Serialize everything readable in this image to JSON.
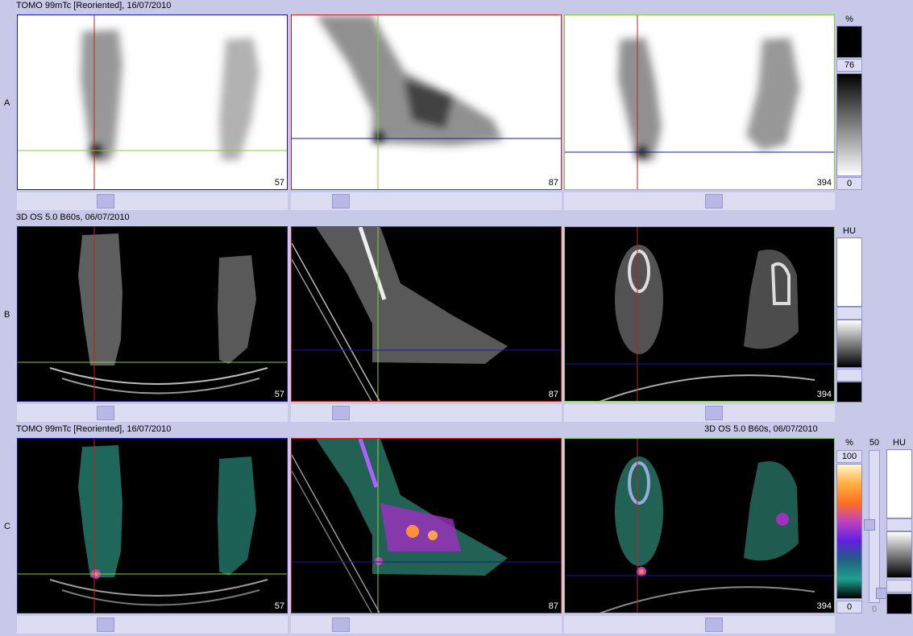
{
  "rows": [
    {
      "label": "A",
      "header": "TOMO 99mTc [Reoriented], 16/07/2010",
      "header_right": "",
      "slices": [
        "57",
        "87",
        "394"
      ]
    },
    {
      "label": "B",
      "header": "3D  OS  5.0  B60s, 06/07/2010",
      "header_right": "",
      "slices": [
        "57",
        "87",
        "394"
      ]
    },
    {
      "label": "C",
      "header": "TOMO 99mTc [Reoriented], 16/07/2010",
      "header_right": "3D  OS  5.0  B60s, 06/07/2010",
      "slices": [
        "57",
        "87",
        "394"
      ]
    }
  ],
  "colorbars": {
    "a": {
      "unit": "%",
      "top": "76",
      "bottom": "0"
    },
    "b": {
      "unit": "HU"
    },
    "c_pct": {
      "unit": "%",
      "top": "100",
      "bottom": "0"
    },
    "c_slider": {
      "top": "50",
      "bottom": "0"
    },
    "c_hu": {
      "unit": "HU"
    }
  },
  "colors": {
    "background": "#c8c8e8",
    "crosshair_red": "#c02020",
    "crosshair_green": "#88cc44",
    "crosshair_blue": "#1a1a9a"
  }
}
